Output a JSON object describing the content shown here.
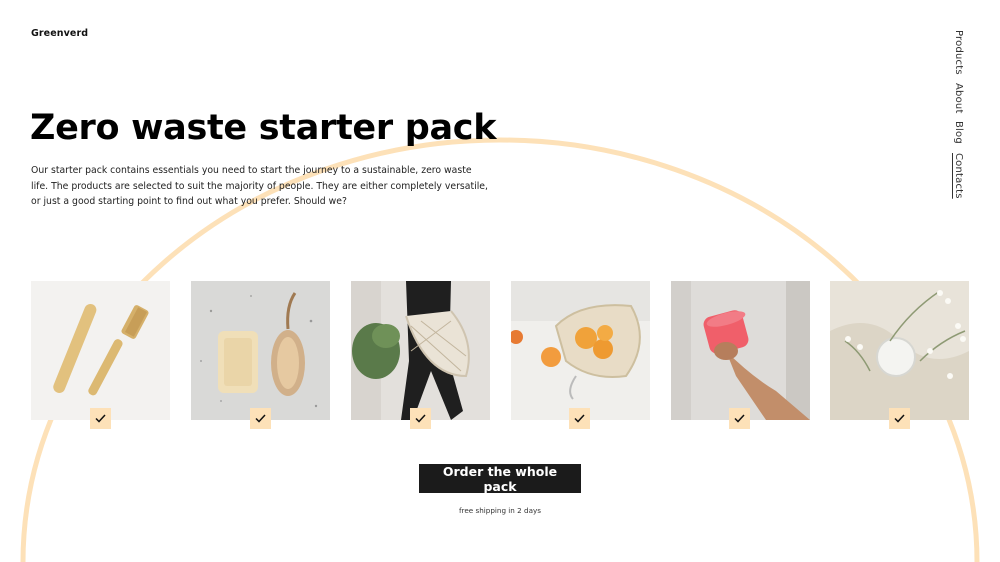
{
  "brand": {
    "name": "Greenverd",
    "accent": "#fde1b8",
    "arc_color": "#fde1b8"
  },
  "nav": {
    "items": [
      {
        "label": "Products"
      },
      {
        "label": "About"
      },
      {
        "label": "Blog"
      },
      {
        "label": "Contacts"
      }
    ]
  },
  "hero": {
    "title": "Zero waste starter pack",
    "description": "Our starter pack contains essentials you need to start the journey to a sustainable, zero waste life. The products are selected to suit the majority of people. They are either completely versatile, or just a good starting point to find out what you prefer. Should we?"
  },
  "products": [
    {
      "name": "bamboo-toothbrush",
      "selected": true,
      "icon": "check-icon"
    },
    {
      "name": "soap-and-brush",
      "selected": true,
      "icon": "check-icon"
    },
    {
      "name": "mesh-tote-bag",
      "selected": true,
      "icon": "check-icon"
    },
    {
      "name": "produce-bag",
      "selected": true,
      "icon": "check-icon"
    },
    {
      "name": "reusable-cup",
      "selected": true,
      "icon": "check-icon"
    },
    {
      "name": "solid-deodorant",
      "selected": true,
      "icon": "check-icon"
    }
  ],
  "cta": {
    "label": "Order the whole pack",
    "note": "free shipping in 2 days"
  }
}
